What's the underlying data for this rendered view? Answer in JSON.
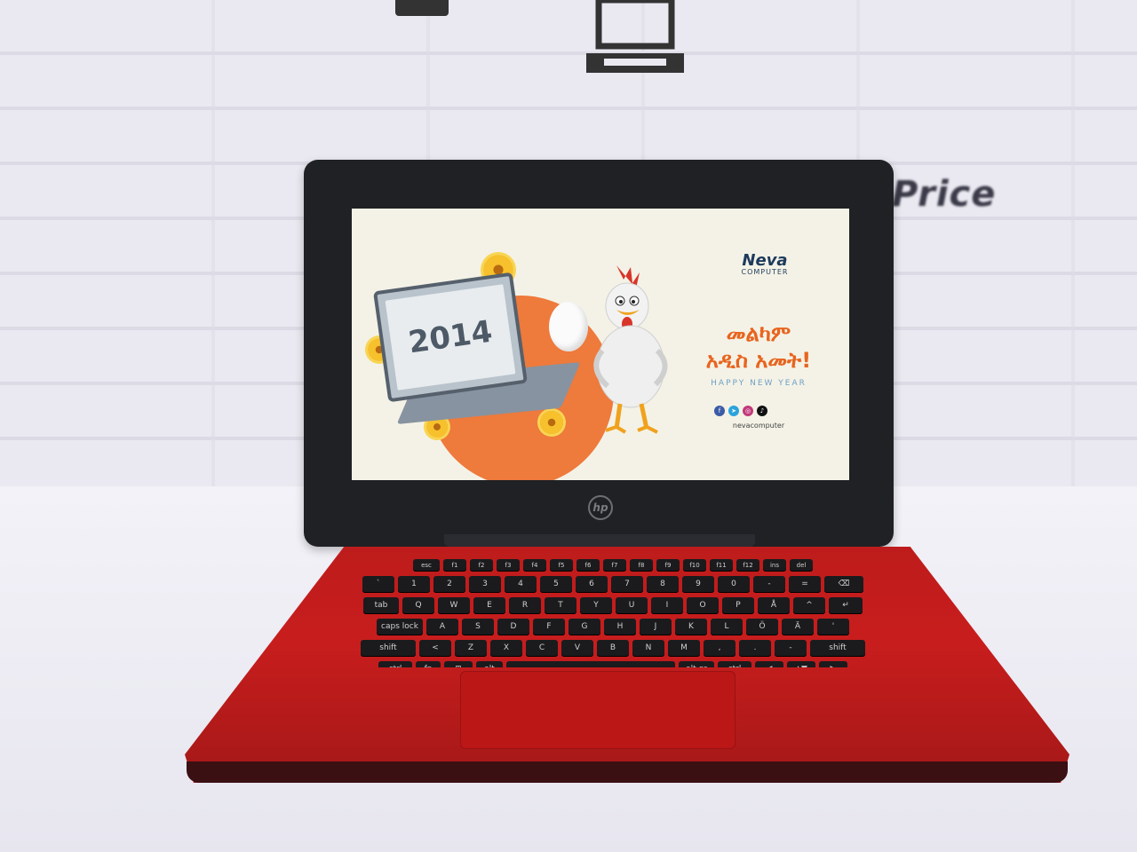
{
  "scene": {
    "wall_text": "Price",
    "device_brand": "hp"
  },
  "screen": {
    "laptop_year": "2014",
    "brand_name": "Neva",
    "brand_sub": "COMPUTER",
    "greeting_line1": "መልካም",
    "greeting_line2": "አዲስ አመት!",
    "greeting_en": "HAPPY NEW YEAR",
    "social_handle": "nevacomputer",
    "social_icons": [
      "facebook-icon",
      "telegram-icon",
      "instagram-icon",
      "tiktok-icon"
    ]
  },
  "keyboard": {
    "row1": [
      "esc",
      "f1",
      "f2",
      "f3",
      "f4",
      "f5",
      "f6",
      "f7",
      "f8",
      "f9",
      "f10",
      "f11",
      "f12",
      "ins",
      "del"
    ],
    "row2": [
      "`",
      "1",
      "2",
      "3",
      "4",
      "5",
      "6",
      "7",
      "8",
      "9",
      "0",
      "-",
      "=",
      "⌫"
    ],
    "row3": [
      "tab",
      "Q",
      "W",
      "E",
      "R",
      "T",
      "Y",
      "U",
      "I",
      "O",
      "P",
      "Å",
      "^",
      "↵"
    ],
    "row4": [
      "caps lock",
      "A",
      "S",
      "D",
      "F",
      "G",
      "H",
      "J",
      "K",
      "L",
      "Ö",
      "Ä",
      "'"
    ],
    "row5": [
      "shift",
      "<",
      "Z",
      "X",
      "C",
      "V",
      "B",
      "N",
      "M",
      ",",
      ".",
      "-",
      "shift"
    ],
    "row6": [
      "ctrl",
      "fn",
      "⊞",
      "alt",
      "",
      "alt gr",
      "ctrl",
      "◀",
      "▲▼",
      "▶"
    ]
  },
  "colors": {
    "chassis_red": "#c81d1d",
    "accent_orange": "#ee7a3c",
    "brand_blue": "#1d3a5c"
  }
}
